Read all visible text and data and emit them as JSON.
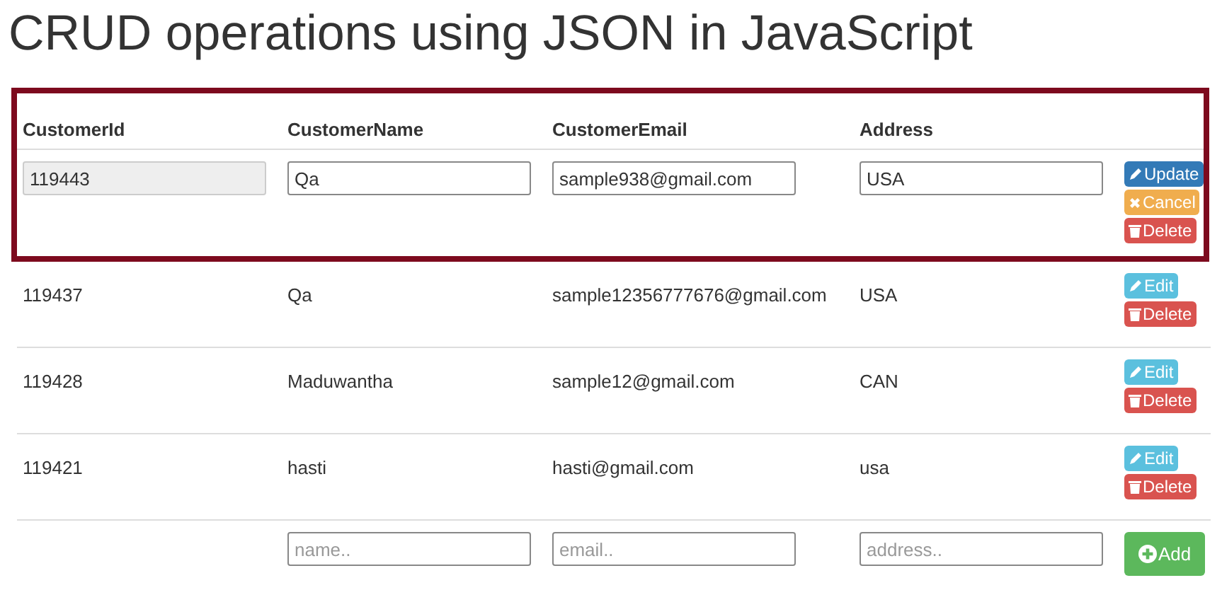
{
  "title": "CRUD operations using JSON in JavaScript",
  "columns": [
    "CustomerId",
    "CustomerName",
    "CustomerEmail",
    "Address"
  ],
  "edit_row": {
    "id": "119443",
    "name": "Qa",
    "email": "sample938@gmail.com",
    "address": "USA",
    "buttons": [
      {
        "kind": "update",
        "label": "Update"
      },
      {
        "kind": "cancel",
        "label": "Cancel"
      },
      {
        "kind": "delete",
        "label": "Delete"
      }
    ]
  },
  "rows": [
    {
      "id": "119437",
      "name": "Qa",
      "email": "sample12356777676@gmail.com",
      "address": "USA",
      "buttons": [
        {
          "kind": "edit",
          "label": "Edit"
        },
        {
          "kind": "delete",
          "label": "Delete"
        }
      ]
    },
    {
      "id": "119428",
      "name": "Maduwantha",
      "email": "sample12@gmail.com",
      "address": "CAN",
      "buttons": [
        {
          "kind": "edit",
          "label": "Edit"
        },
        {
          "kind": "delete",
          "label": "Delete"
        }
      ]
    },
    {
      "id": "119421",
      "name": "hasti",
      "email": "hasti@gmail.com",
      "address": "usa",
      "buttons": [
        {
          "kind": "edit",
          "label": "Edit"
        },
        {
          "kind": "delete",
          "label": "Delete"
        }
      ]
    }
  ],
  "new_row": {
    "name_placeholder": "name..",
    "email_placeholder": "email..",
    "address_placeholder": "address..",
    "button": {
      "kind": "add",
      "label": "Add"
    }
  }
}
